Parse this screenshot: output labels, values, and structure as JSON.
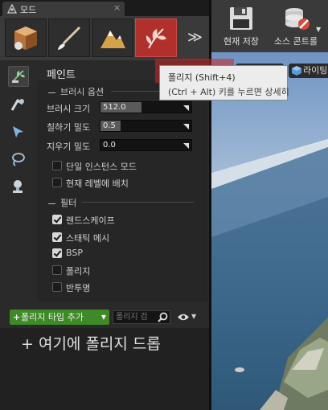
{
  "tab": {
    "title": "모드",
    "close": "×"
  },
  "modes": {
    "active": "foliage",
    "items": [
      {
        "id": "place",
        "icon": "cube-box-icon"
      },
      {
        "id": "paint",
        "icon": "paintbrush-icon"
      },
      {
        "id": "landscape",
        "icon": "mountain-icon"
      },
      {
        "id": "foliage",
        "icon": "leaf-icon"
      }
    ],
    "more": "≫"
  },
  "tools": [
    {
      "id": "paint",
      "icon": "paint-foliage-icon",
      "active": true
    },
    {
      "id": "reapply",
      "icon": "reapply-icon"
    },
    {
      "id": "select",
      "icon": "select-arrow-icon"
    },
    {
      "id": "lasso",
      "icon": "lasso-icon"
    },
    {
      "id": "fill",
      "icon": "fill-icon"
    }
  ],
  "settings": {
    "title": "페인트",
    "brush_section": "브러시 옵션",
    "brush_size": {
      "label": "브러시 크기",
      "value": "512.0",
      "fill": 1.0
    },
    "paint_density": {
      "label": "칠하기 밀도",
      "value": "0.5",
      "fill": 0.5
    },
    "erase_density": {
      "label": "지우기 밀도",
      "value": "0.0",
      "fill": 0.0
    },
    "single_instance": {
      "label": "단일 인스턴스 모드",
      "checked": false
    },
    "current_level": {
      "label": "현재 레벨에 배치",
      "checked": false
    },
    "filter_section": "필터",
    "filters": [
      {
        "label": "랜드스케이프",
        "checked": true
      },
      {
        "label": "스태틱 메시",
        "checked": true
      },
      {
        "label": "BSP",
        "checked": true
      },
      {
        "label": "폴리지",
        "checked": false
      },
      {
        "label": "반투명",
        "checked": false
      }
    ]
  },
  "foliage_types": {
    "add_label": "폴리지 타입 추가",
    "search_placeholder": "폴리지 검",
    "drop_hint": "+ 여기에 폴리지 드롭"
  },
  "toolbar": {
    "save_label": "현재 저장",
    "source_control_label": "소스 콘트롤"
  },
  "viewport": {
    "lighting_label": "라이팅"
  },
  "tooltip": {
    "title": "폴리지 (Shift+4)",
    "description": "(Ctrl + Alt) 키를 누르면 상세히"
  },
  "colors": {
    "accent_foliage": "#b0302b",
    "add_button": "#3d8a26",
    "panel_bg": "#2a2a2a"
  }
}
